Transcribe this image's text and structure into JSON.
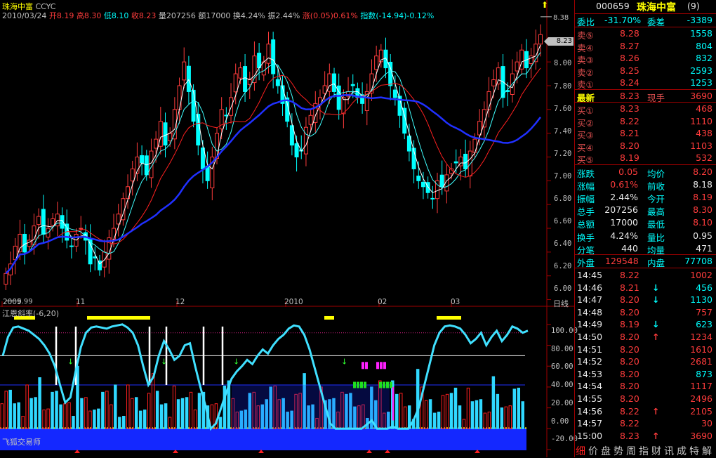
{
  "stock": {
    "name": "珠海中富",
    "title_code": "CCYC",
    "date": "2010/03/24",
    "open": "开8.19",
    "high": "高8.30",
    "low": "低8.10",
    "close": "收8.23",
    "volume": "量207256",
    "amount": "额17000",
    "turnover": "换4.24%",
    "amplitude": "振2.44%",
    "change": "涨(0.05)0.61%",
    "index": "指数(-14.94)-0.12%"
  },
  "main_chart": {
    "y_ticks": [
      "8.20",
      "8.00",
      "7.80",
      "7.60",
      "7.40",
      "7.20",
      "7.00",
      "6.80",
      "6.60",
      "6.40",
      "6.20",
      "6.00"
    ],
    "x_ticks": [
      "2009",
      "11",
      "12",
      "2010",
      "02",
      "03"
    ],
    "period": "日线",
    "max_label": "8.38",
    "min_label": "5.99",
    "last_price": "8.23"
  },
  "indicator": {
    "title": "江恩斜率(-6,20)",
    "y_ticks": [
      "100.00",
      "80.00",
      "60.00",
      "40.00",
      "20.00",
      "0.00",
      "-20.00"
    ],
    "bottom_label": "飞狐交易师"
  },
  "chart_data": {
    "type": "candlestick",
    "ylim": [
      5.95,
      8.45
    ],
    "y_ticks": [
      6.0,
      6.2,
      6.4,
      6.6,
      6.8,
      7.0,
      7.2,
      7.4,
      7.6,
      7.8,
      8.0,
      8.2
    ],
    "x_ticks": [
      "2009",
      "11",
      "12",
      "2010",
      "02",
      "03"
    ],
    "max": 8.38,
    "min": 5.99,
    "last": 8.23,
    "closes": [
      6.22,
      6.3,
      6.45,
      6.55,
      6.4,
      6.5,
      6.62,
      6.7,
      6.55,
      6.6,
      6.68,
      6.72,
      6.6,
      6.5,
      6.45,
      6.55,
      6.6,
      6.5,
      6.3,
      6.35,
      6.25,
      6.4,
      6.52,
      6.6,
      6.72,
      6.85,
      6.95,
      7.1,
      7.2,
      7.15,
      7.05,
      7.25,
      7.35,
      7.5,
      7.3,
      7.4,
      7.6,
      7.8,
      8.0,
      7.75,
      7.5,
      7.3,
      7.1,
      7.0,
      7.2,
      7.4,
      7.6,
      7.55,
      7.7,
      7.9,
      7.95,
      7.75,
      7.85,
      8.05,
      7.95,
      8.0,
      8.15,
      7.9,
      7.8,
      7.65,
      7.5,
      7.3,
      7.2,
      7.25,
      7.45,
      7.55,
      7.65,
      7.7,
      7.8,
      7.9,
      7.75,
      7.6,
      7.7,
      7.75,
      7.8,
      7.7,
      7.65,
      7.75,
      7.9,
      8.05,
      8.1,
      7.95,
      7.8,
      7.7,
      7.55,
      7.4,
      7.25,
      7.1,
      7.0,
      6.95,
      6.9,
      6.85,
      7.0,
      6.95,
      7.05,
      7.1,
      7.15,
      7.2,
      7.1,
      7.25,
      7.35,
      7.5,
      7.6,
      7.75,
      7.85,
      7.95,
      7.7,
      7.75,
      7.9,
      8.0,
      8.1,
      7.95,
      8.05,
      8.15,
      8.23
    ]
  },
  "indicator_data": {
    "ylim": [
      -22,
      110
    ],
    "line": [
      70,
      88,
      97,
      98,
      96,
      94,
      90,
      86,
      80,
      72,
      60,
      42,
      25,
      30,
      55,
      78,
      92,
      97,
      98,
      97,
      96,
      98,
      99,
      100,
      97,
      92,
      80,
      60,
      42,
      50,
      70,
      84,
      76,
      66,
      70,
      80,
      82,
      60,
      40,
      22,
      0,
      5,
      20,
      35,
      48,
      55,
      60,
      66,
      62,
      70,
      76,
      72,
      80,
      86,
      90,
      96,
      99,
      98,
      90,
      76,
      58,
      40,
      22,
      5,
      0,
      0,
      0,
      0,
      0,
      0,
      4,
      8,
      0,
      0,
      0,
      2,
      0,
      0,
      0,
      8,
      20,
      40,
      60,
      80,
      92,
      98,
      99,
      98,
      96,
      90,
      82,
      86,
      92,
      80,
      88,
      94,
      84,
      90,
      98,
      96,
      92,
      94
    ]
  },
  "quote_panel": {
    "code": "000659",
    "name": "珠海中富",
    "suffix": "(9)",
    "weibi_label": "委比",
    "weibi": "-31.70%",
    "weicha_label": "委差",
    "weicha": "-3389",
    "asks": [
      {
        "label": "卖⑤",
        "price": "8.28",
        "vol": "1558"
      },
      {
        "label": "卖④",
        "price": "8.27",
        "vol": "804"
      },
      {
        "label": "卖③",
        "price": "8.26",
        "vol": "832"
      },
      {
        "label": "卖②",
        "price": "8.25",
        "vol": "2593"
      },
      {
        "label": "卖①",
        "price": "8.24",
        "vol": "1253"
      }
    ],
    "latest_label": "最新",
    "latest": "8.23",
    "xianshou_label": "现手",
    "xianshou": "3690",
    "bids": [
      {
        "label": "买①",
        "price": "8.23",
        "vol": "468"
      },
      {
        "label": "买②",
        "price": "8.22",
        "vol": "1110"
      },
      {
        "label": "买③",
        "price": "8.21",
        "vol": "438"
      },
      {
        "label": "买④",
        "price": "8.20",
        "vol": "1103"
      },
      {
        "label": "买⑤",
        "price": "8.19",
        "vol": "532"
      }
    ],
    "stats": [
      {
        "l1": "涨跌",
        "v1": "0.05",
        "l2": "均价",
        "v2": "8.20",
        "c1": "red",
        "c2": "red"
      },
      {
        "l1": "涨幅",
        "v1": "0.61%",
        "l2": "前收",
        "v2": "8.18",
        "c1": "red",
        "c2": "white"
      },
      {
        "l1": "振幅",
        "v1": "2.44%",
        "l2": "今开",
        "v2": "8.19",
        "c1": "white",
        "c2": "red"
      },
      {
        "l1": "总手",
        "v1": "207256",
        "l2": "最高",
        "v2": "8.30",
        "c1": "white",
        "c2": "red"
      },
      {
        "l1": "总额",
        "v1": "17000",
        "l2": "最低",
        "v2": "8.10",
        "c1": "white",
        "c2": "red"
      },
      {
        "l1": "换手",
        "v1": "4.24%",
        "l2": "量比",
        "v2": "0.95",
        "c1": "white",
        "c2": "white"
      },
      {
        "l1": "分笔",
        "v1": "440",
        "l2": "均量",
        "v2": "471",
        "c1": "white",
        "c2": "white"
      }
    ],
    "waipan_label": "外盘",
    "waipan": "129548",
    "neipan_label": "内盘",
    "neipan": "77708",
    "ticks": [
      {
        "t": "14:45",
        "p": "8.22",
        "d": "",
        "v": "1002",
        "vc": "red"
      },
      {
        "t": "14:46",
        "p": "8.21",
        "d": "↓",
        "v": "456",
        "vc": "cyan"
      },
      {
        "t": "14:47",
        "p": "8.20",
        "d": "↓",
        "v": "1130",
        "vc": "cyan"
      },
      {
        "t": "14:48",
        "p": "8.20",
        "d": "",
        "v": "757",
        "vc": "red"
      },
      {
        "t": "14:49",
        "p": "8.19",
        "d": "↓",
        "v": "623",
        "vc": "cyan"
      },
      {
        "t": "14:50",
        "p": "8.20",
        "d": "↑",
        "v": "1234",
        "vc": "red"
      },
      {
        "t": "14:51",
        "p": "8.20",
        "d": "",
        "v": "1610",
        "vc": "red"
      },
      {
        "t": "14:52",
        "p": "8.20",
        "d": "",
        "v": "2681",
        "vc": "red"
      },
      {
        "t": "14:53",
        "p": "8.20",
        "d": "",
        "v": "873",
        "vc": "cyan"
      },
      {
        "t": "14:54",
        "p": "8.20",
        "d": "",
        "v": "1117",
        "vc": "red"
      },
      {
        "t": "14:55",
        "p": "8.20",
        "d": "",
        "v": "2496",
        "vc": "red"
      },
      {
        "t": "14:56",
        "p": "8.22",
        "d": "↑",
        "v": "2105",
        "vc": "red"
      },
      {
        "t": "14:57",
        "p": "8.22",
        "d": "",
        "v": "30",
        "vc": "red"
      },
      {
        "t": "15:00",
        "p": "8.23",
        "d": "↑",
        "v": "3690",
        "vc": "red"
      }
    ],
    "bottom_tabs": [
      "细",
      "价",
      "盘",
      "势",
      "周",
      "指",
      "财",
      "讯",
      "成",
      "特",
      "解"
    ]
  },
  "colors": {
    "up": "#ff3c3c",
    "down": "#00ffff",
    "ma_long": "#2030ff",
    "panel_border": "#a00000",
    "indicator_line": "#40e0ff"
  }
}
